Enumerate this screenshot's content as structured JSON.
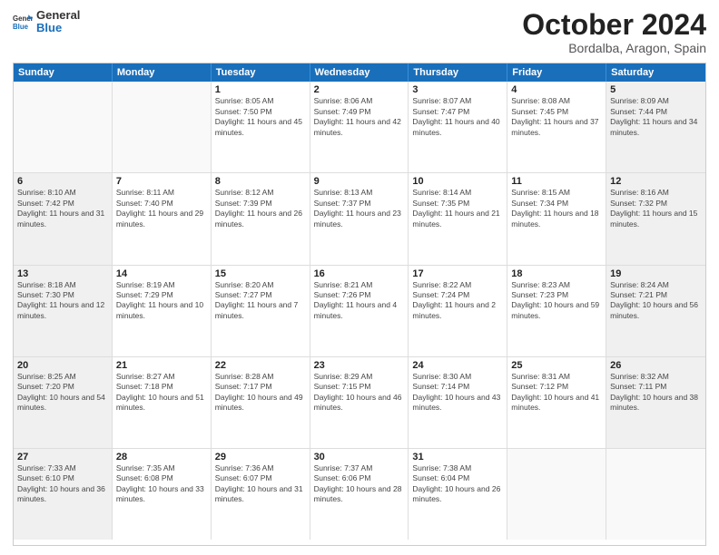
{
  "header": {
    "logo_general": "General",
    "logo_blue": "Blue",
    "month": "October 2024",
    "location": "Bordalba, Aragon, Spain"
  },
  "days_of_week": [
    "Sunday",
    "Monday",
    "Tuesday",
    "Wednesday",
    "Thursday",
    "Friday",
    "Saturday"
  ],
  "weeks": [
    [
      {
        "day": "",
        "text": "",
        "shaded": false,
        "empty": true
      },
      {
        "day": "",
        "text": "",
        "shaded": false,
        "empty": true
      },
      {
        "day": "1",
        "text": "Sunrise: 8:05 AM\nSunset: 7:50 PM\nDaylight: 11 hours and 45 minutes.",
        "shaded": false,
        "empty": false
      },
      {
        "day": "2",
        "text": "Sunrise: 8:06 AM\nSunset: 7:49 PM\nDaylight: 11 hours and 42 minutes.",
        "shaded": false,
        "empty": false
      },
      {
        "day": "3",
        "text": "Sunrise: 8:07 AM\nSunset: 7:47 PM\nDaylight: 11 hours and 40 minutes.",
        "shaded": false,
        "empty": false
      },
      {
        "day": "4",
        "text": "Sunrise: 8:08 AM\nSunset: 7:45 PM\nDaylight: 11 hours and 37 minutes.",
        "shaded": false,
        "empty": false
      },
      {
        "day": "5",
        "text": "Sunrise: 8:09 AM\nSunset: 7:44 PM\nDaylight: 11 hours and 34 minutes.",
        "shaded": true,
        "empty": false
      }
    ],
    [
      {
        "day": "6",
        "text": "Sunrise: 8:10 AM\nSunset: 7:42 PM\nDaylight: 11 hours and 31 minutes.",
        "shaded": true,
        "empty": false
      },
      {
        "day": "7",
        "text": "Sunrise: 8:11 AM\nSunset: 7:40 PM\nDaylight: 11 hours and 29 minutes.",
        "shaded": false,
        "empty": false
      },
      {
        "day": "8",
        "text": "Sunrise: 8:12 AM\nSunset: 7:39 PM\nDaylight: 11 hours and 26 minutes.",
        "shaded": false,
        "empty": false
      },
      {
        "day": "9",
        "text": "Sunrise: 8:13 AM\nSunset: 7:37 PM\nDaylight: 11 hours and 23 minutes.",
        "shaded": false,
        "empty": false
      },
      {
        "day": "10",
        "text": "Sunrise: 8:14 AM\nSunset: 7:35 PM\nDaylight: 11 hours and 21 minutes.",
        "shaded": false,
        "empty": false
      },
      {
        "day": "11",
        "text": "Sunrise: 8:15 AM\nSunset: 7:34 PM\nDaylight: 11 hours and 18 minutes.",
        "shaded": false,
        "empty": false
      },
      {
        "day": "12",
        "text": "Sunrise: 8:16 AM\nSunset: 7:32 PM\nDaylight: 11 hours and 15 minutes.",
        "shaded": true,
        "empty": false
      }
    ],
    [
      {
        "day": "13",
        "text": "Sunrise: 8:18 AM\nSunset: 7:30 PM\nDaylight: 11 hours and 12 minutes.",
        "shaded": true,
        "empty": false
      },
      {
        "day": "14",
        "text": "Sunrise: 8:19 AM\nSunset: 7:29 PM\nDaylight: 11 hours and 10 minutes.",
        "shaded": false,
        "empty": false
      },
      {
        "day": "15",
        "text": "Sunrise: 8:20 AM\nSunset: 7:27 PM\nDaylight: 11 hours and 7 minutes.",
        "shaded": false,
        "empty": false
      },
      {
        "day": "16",
        "text": "Sunrise: 8:21 AM\nSunset: 7:26 PM\nDaylight: 11 hours and 4 minutes.",
        "shaded": false,
        "empty": false
      },
      {
        "day": "17",
        "text": "Sunrise: 8:22 AM\nSunset: 7:24 PM\nDaylight: 11 hours and 2 minutes.",
        "shaded": false,
        "empty": false
      },
      {
        "day": "18",
        "text": "Sunrise: 8:23 AM\nSunset: 7:23 PM\nDaylight: 10 hours and 59 minutes.",
        "shaded": false,
        "empty": false
      },
      {
        "day": "19",
        "text": "Sunrise: 8:24 AM\nSunset: 7:21 PM\nDaylight: 10 hours and 56 minutes.",
        "shaded": true,
        "empty": false
      }
    ],
    [
      {
        "day": "20",
        "text": "Sunrise: 8:25 AM\nSunset: 7:20 PM\nDaylight: 10 hours and 54 minutes.",
        "shaded": true,
        "empty": false
      },
      {
        "day": "21",
        "text": "Sunrise: 8:27 AM\nSunset: 7:18 PM\nDaylight: 10 hours and 51 minutes.",
        "shaded": false,
        "empty": false
      },
      {
        "day": "22",
        "text": "Sunrise: 8:28 AM\nSunset: 7:17 PM\nDaylight: 10 hours and 49 minutes.",
        "shaded": false,
        "empty": false
      },
      {
        "day": "23",
        "text": "Sunrise: 8:29 AM\nSunset: 7:15 PM\nDaylight: 10 hours and 46 minutes.",
        "shaded": false,
        "empty": false
      },
      {
        "day": "24",
        "text": "Sunrise: 8:30 AM\nSunset: 7:14 PM\nDaylight: 10 hours and 43 minutes.",
        "shaded": false,
        "empty": false
      },
      {
        "day": "25",
        "text": "Sunrise: 8:31 AM\nSunset: 7:12 PM\nDaylight: 10 hours and 41 minutes.",
        "shaded": false,
        "empty": false
      },
      {
        "day": "26",
        "text": "Sunrise: 8:32 AM\nSunset: 7:11 PM\nDaylight: 10 hours and 38 minutes.",
        "shaded": true,
        "empty": false
      }
    ],
    [
      {
        "day": "27",
        "text": "Sunrise: 7:33 AM\nSunset: 6:10 PM\nDaylight: 10 hours and 36 minutes.",
        "shaded": true,
        "empty": false
      },
      {
        "day": "28",
        "text": "Sunrise: 7:35 AM\nSunset: 6:08 PM\nDaylight: 10 hours and 33 minutes.",
        "shaded": false,
        "empty": false
      },
      {
        "day": "29",
        "text": "Sunrise: 7:36 AM\nSunset: 6:07 PM\nDaylight: 10 hours and 31 minutes.",
        "shaded": false,
        "empty": false
      },
      {
        "day": "30",
        "text": "Sunrise: 7:37 AM\nSunset: 6:06 PM\nDaylight: 10 hours and 28 minutes.",
        "shaded": false,
        "empty": false
      },
      {
        "day": "31",
        "text": "Sunrise: 7:38 AM\nSunset: 6:04 PM\nDaylight: 10 hours and 26 minutes.",
        "shaded": false,
        "empty": false
      },
      {
        "day": "",
        "text": "",
        "shaded": false,
        "empty": true
      },
      {
        "day": "",
        "text": "",
        "shaded": true,
        "empty": true
      }
    ]
  ]
}
